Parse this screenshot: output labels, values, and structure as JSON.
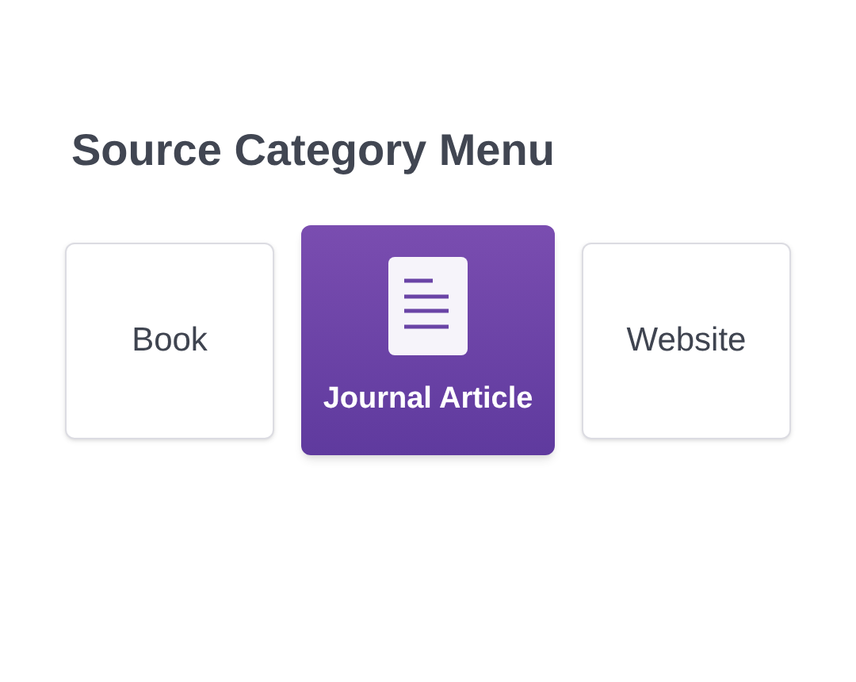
{
  "title": "Source Category Menu",
  "categories": [
    {
      "label": "Book",
      "selected": false
    },
    {
      "label": "Journal Article",
      "selected": true
    },
    {
      "label": "Website",
      "selected": false
    }
  ]
}
